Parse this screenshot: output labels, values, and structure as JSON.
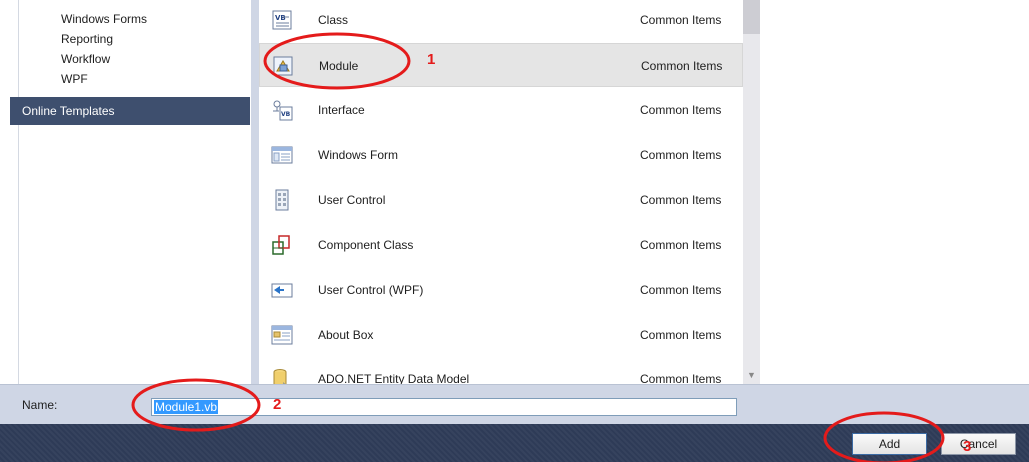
{
  "left_panel": {
    "tree_items": [
      "Windows Forms",
      "Reporting",
      "Workflow",
      "WPF"
    ],
    "online_templates": "Online Templates"
  },
  "templates": [
    {
      "name": "Class",
      "category": "Common Items",
      "icon": "vb-class-icon"
    },
    {
      "name": "Module",
      "category": "Common Items",
      "icon": "vb-module-icon",
      "selected": true
    },
    {
      "name": "Interface",
      "category": "Common Items",
      "icon": "vb-interface-icon"
    },
    {
      "name": "Windows Form",
      "category": "Common Items",
      "icon": "windows-form-icon"
    },
    {
      "name": "User Control",
      "category": "Common Items",
      "icon": "user-control-icon"
    },
    {
      "name": "Component Class",
      "category": "Common Items",
      "icon": "component-class-icon"
    },
    {
      "name": "User Control (WPF)",
      "category": "Common Items",
      "icon": "wpf-user-control-icon"
    },
    {
      "name": "About Box",
      "category": "Common Items",
      "icon": "about-box-icon"
    },
    {
      "name": "ADO.NET Entity Data Model",
      "category": "Common Items",
      "icon": "entity-data-model-icon"
    }
  ],
  "name_field": {
    "label": "Name:",
    "value": "Module1.vb"
  },
  "buttons": {
    "add": "Add",
    "cancel": "Cancel"
  },
  "annotations": [
    "1",
    "2",
    "3"
  ],
  "colors": {
    "selection_bar": "#3e4f6e",
    "bottom_bar": "#2e3b57",
    "annotation_red": "#e41b1b",
    "input_selection": "#3399ff"
  }
}
